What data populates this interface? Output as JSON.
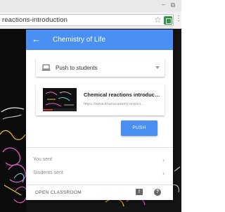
{
  "browser": {
    "url": "reactions-introduction"
  },
  "popup": {
    "title": "Chemistry of Life",
    "target_select": {
      "value": "Push to students"
    },
    "content_card": {
      "title": "Chemical reactions introducti...",
      "url": "https://www.khanacademy.org/sci..."
    },
    "push_label": "PUSH",
    "rows": [
      {
        "label": "You sent"
      },
      {
        "label": "Students sent"
      }
    ],
    "footer": {
      "open_classroom_label": "OPEN CLASSROOM"
    }
  },
  "colors": {
    "accent": "#4a8ff2",
    "chrome": "#f2f2f2"
  }
}
